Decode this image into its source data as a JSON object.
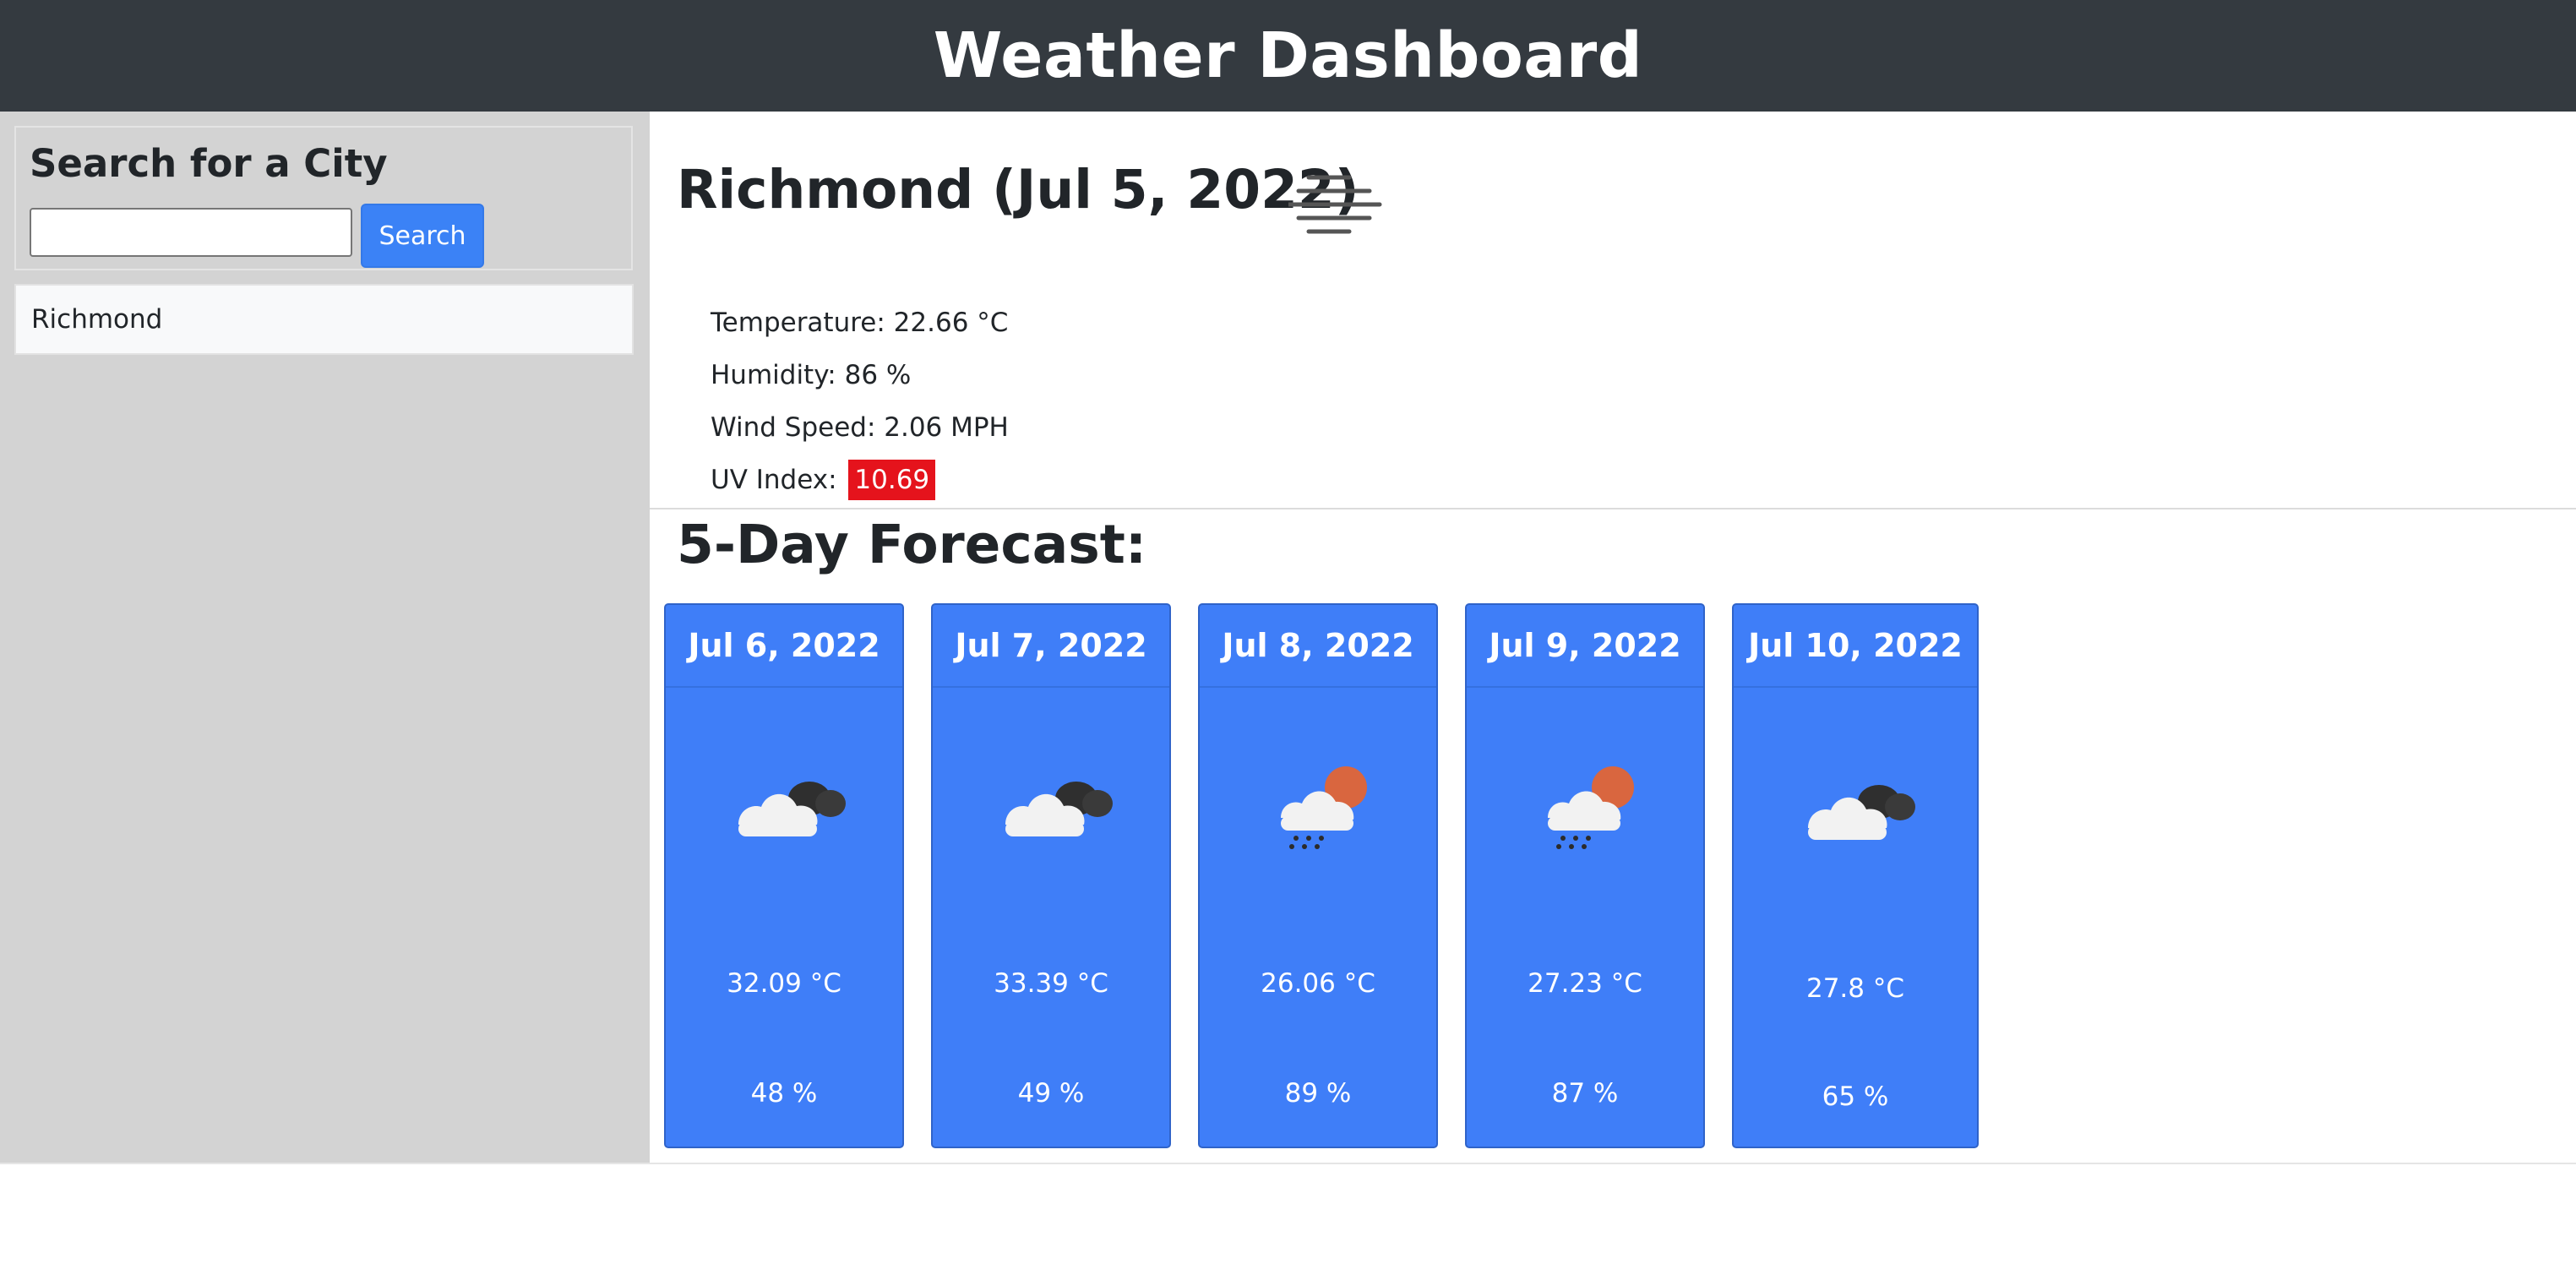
{
  "header": {
    "title": "Weather Dashboard"
  },
  "sidebar": {
    "search_title": "Search for a City",
    "search_placeholder": "",
    "search_value": "",
    "search_button": "Search",
    "history": [
      {
        "label": "Richmond"
      }
    ]
  },
  "current": {
    "title": "Richmond (Jul 5, 2022)",
    "icon": "mist-icon",
    "temperature_text": "Temperature: 22.66 °C",
    "humidity_text": "Humidity: 86 %",
    "wind_text": "Wind Speed: 2.06 MPH",
    "uv_label": "UV Index:",
    "uv_value": "10.69",
    "uv_color": "#e5131c"
  },
  "forecast": {
    "title": "5-Day Forecast:",
    "card_color": "#3f7ef8",
    "days": [
      {
        "date": "Jul 6, 2022",
        "icon": "cloudy-icon",
        "temp": "32.09 °C",
        "humidity": "48 %"
      },
      {
        "date": "Jul 7, 2022",
        "icon": "cloudy-icon",
        "temp": "33.39 °C",
        "humidity": "49 %"
      },
      {
        "date": "Jul 8, 2022",
        "icon": "sun-rain-icon",
        "temp": "26.06 °C",
        "humidity": "89 %"
      },
      {
        "date": "Jul 9, 2022",
        "icon": "sun-rain-icon",
        "temp": "27.23 °C",
        "humidity": "87 %"
      },
      {
        "date": "Jul 10, 2022",
        "icon": "cloudy-icon",
        "temp": "27.8 °C",
        "humidity": "65 %"
      }
    ]
  }
}
